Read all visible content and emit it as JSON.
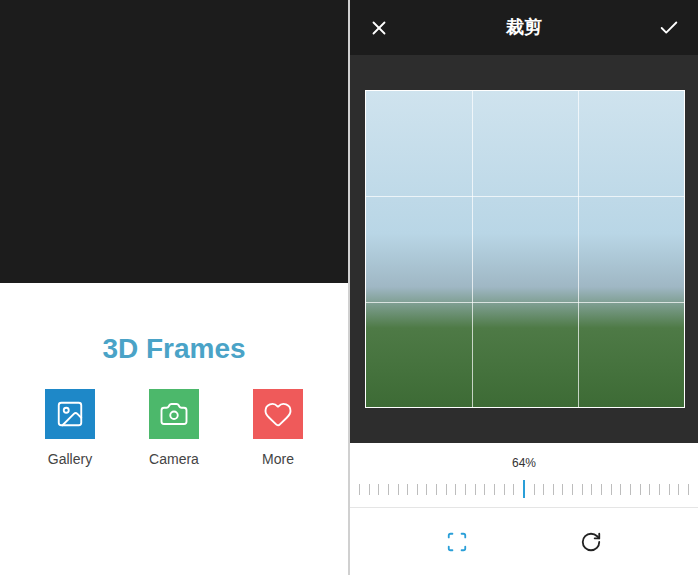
{
  "launcher": {
    "title": "3D Frames",
    "buttons": [
      {
        "label": "Gallery",
        "color": "#1e88c8"
      },
      {
        "label": "Camera",
        "color": "#4cb86b"
      },
      {
        "label": "More",
        "color": "#ef5a5a"
      }
    ]
  },
  "editor": {
    "title": "裁剪",
    "slider": {
      "reading": "64%",
      "level": 0.49
    },
    "tools": [
      {
        "name": "crop",
        "selected": true
      },
      {
        "name": "rotate",
        "selected": false
      }
    ]
  }
}
